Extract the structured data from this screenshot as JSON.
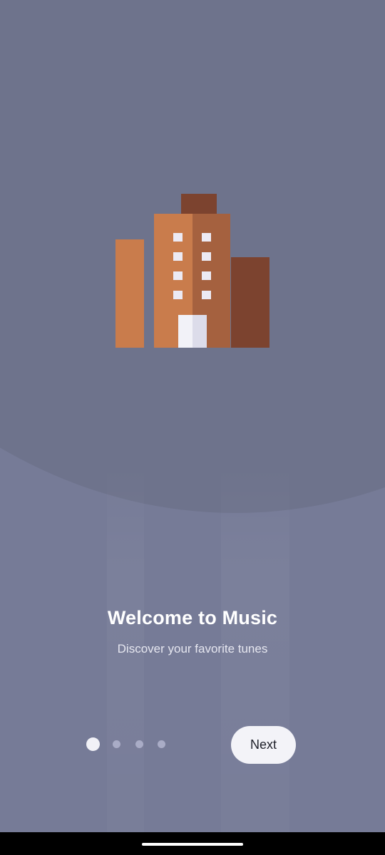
{
  "onboarding": {
    "title": "Welcome to Music",
    "subtitle": "Discover your favorite tunes",
    "illustration_icon": "building-icon",
    "pages": {
      "total": 4,
      "current": 1
    }
  },
  "actions": {
    "next_label": "Next"
  },
  "colors": {
    "background_top": "#6e738c",
    "background_bottom": "#767b97",
    "button_bg": "#f3f3f8",
    "dot_active": "#f1f1f7",
    "dot_inactive": "#a9acc6",
    "building_light": "#c97c4c",
    "building_mid": "#b5683f",
    "building_dark": "#7c432f"
  }
}
